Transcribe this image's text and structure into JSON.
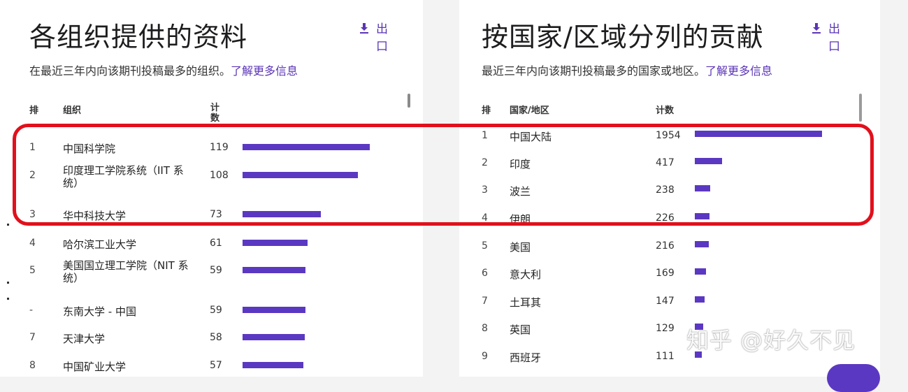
{
  "left_panel": {
    "title": "各组织提供的资料",
    "export_label": "出口",
    "subtitle": "在最近三年内向该期刊投稿最多的组织。",
    "learn_more": "了解更多信息",
    "columns": {
      "rank": "排",
      "name": "组织",
      "count": "计数"
    },
    "rows": [
      {
        "rank": "1",
        "name": "中国科学院",
        "count": "119",
        "value": 119
      },
      {
        "rank": "2",
        "name": "印度理工学院系统（IIT 系统）",
        "count": "108",
        "value": 108
      },
      {
        "rank": "3",
        "name": "华中科技大学",
        "count": "73",
        "value": 73
      },
      {
        "rank": "4",
        "name": "哈尔滨工业大学",
        "count": "61",
        "value": 61
      },
      {
        "rank": "5",
        "name": "美国国立理工学院（NIT 系统）",
        "count": "59",
        "value": 59
      },
      {
        "rank": "-",
        "name": "东南大学 - 中国",
        "count": "59",
        "value": 59
      },
      {
        "rank": "7",
        "name": "天津大学",
        "count": "58",
        "value": 58
      },
      {
        "rank": "8",
        "name": "中国矿业大学",
        "count": "57",
        "value": 57
      }
    ]
  },
  "right_panel": {
    "title": "按国家/区域分列的贡献",
    "export_label": "出口",
    "subtitle": "最近三年内向该期刊投稿最多的国家或地区。",
    "learn_more": "了解更多信息",
    "columns": {
      "rank": "排",
      "name": "国家/地区",
      "count": "计数"
    },
    "rows": [
      {
        "rank": "1",
        "name": "中国大陆",
        "count": "1954",
        "value": 1954
      },
      {
        "rank": "2",
        "name": "印度",
        "count": "417",
        "value": 417
      },
      {
        "rank": "3",
        "name": "波兰",
        "count": "238",
        "value": 238
      },
      {
        "rank": "4",
        "name": "伊朗",
        "count": "226",
        "value": 226
      },
      {
        "rank": "5",
        "name": "美国",
        "count": "216",
        "value": 216
      },
      {
        "rank": "6",
        "name": "意大利",
        "count": "169",
        "value": 169
      },
      {
        "rank": "7",
        "name": "土耳其",
        "count": "147",
        "value": 147
      },
      {
        "rank": "8",
        "name": "英国",
        "count": "129",
        "value": 129
      },
      {
        "rank": "9",
        "name": "西班牙",
        "count": "111",
        "value": 111
      }
    ]
  },
  "watermark": "知乎 @好久不见",
  "colors": {
    "accent": "#5b38c2",
    "highlight": "#e1101c",
    "link": "#5a34b6"
  }
}
